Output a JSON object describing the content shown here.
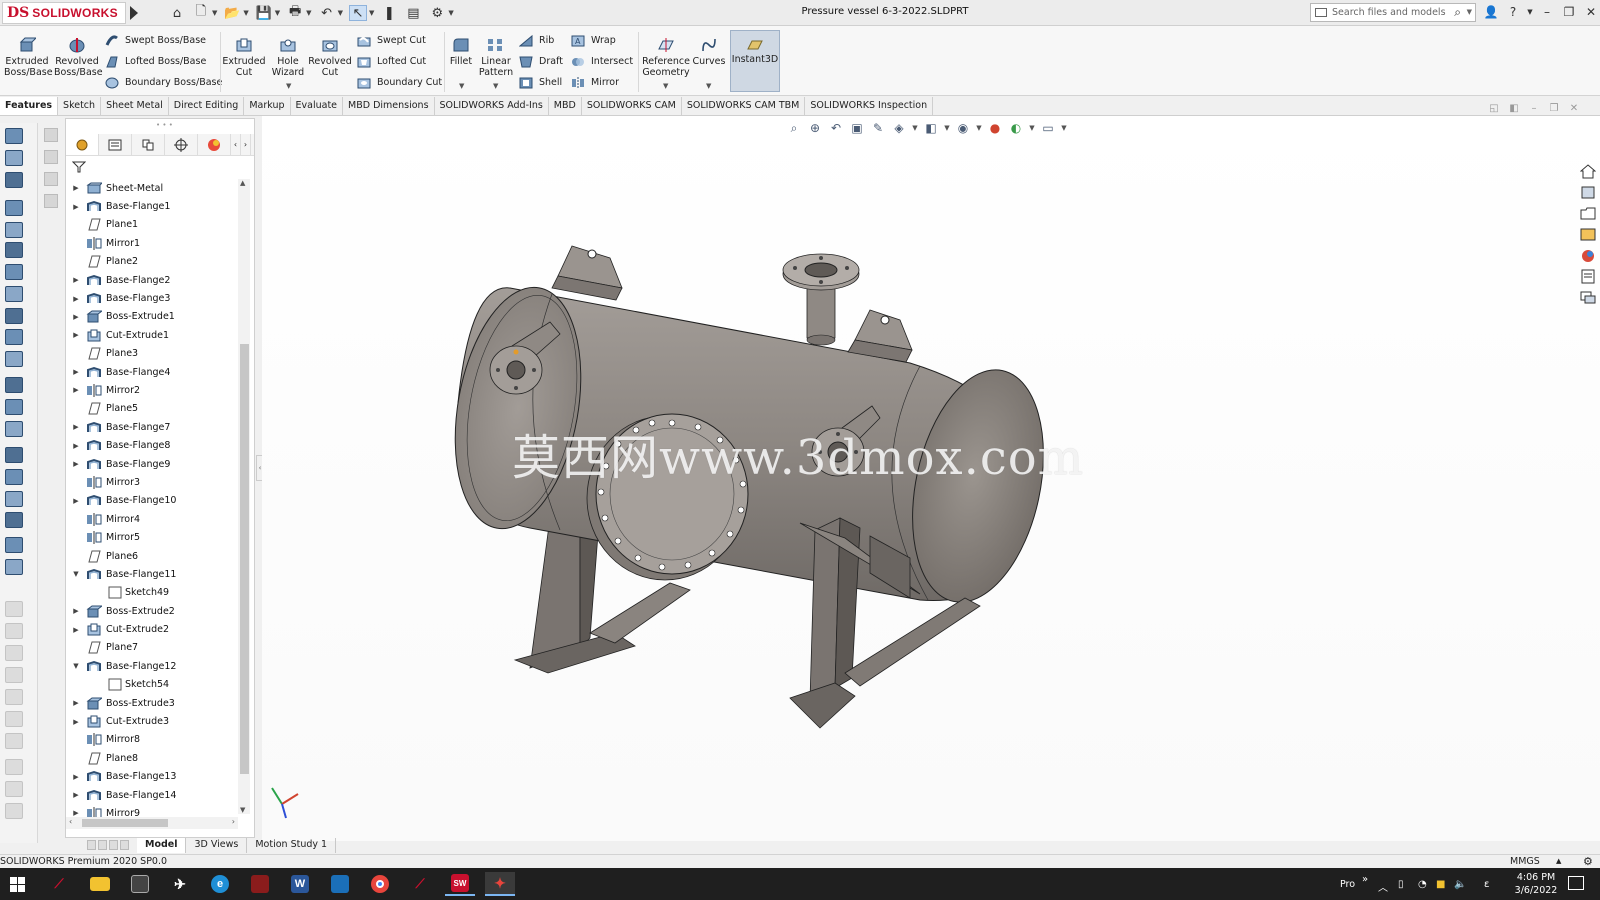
{
  "app": {
    "document_title": "Pressure vessel 6-3-2022.SLDPRT",
    "search_placeholder": "Search files and models",
    "logo_ds": "DS",
    "logo_brand": "SOLIDWORKS"
  },
  "ribbon": {
    "extruded_boss": "Extruded Boss/Base",
    "revolved_boss": "Revolved Boss/Base",
    "swept_boss": "Swept Boss/Base",
    "lofted_boss": "Lofted Boss/Base",
    "boundary_boss": "Boundary Boss/Base",
    "extruded_cut": "Extruded Cut",
    "hole_wizard": "Hole Wizard",
    "revolved_cut": "Revolved Cut",
    "swept_cut": "Swept Cut",
    "lofted_cut": "Lofted Cut",
    "boundary_cut": "Boundary Cut",
    "fillet": "Fillet",
    "linear_pattern": "Linear Pattern",
    "rib": "Rib",
    "draft": "Draft",
    "shell": "Shell",
    "wrap": "Wrap",
    "intersect": "Intersect",
    "mirror": "Mirror",
    "reference_geometry": "Reference Geometry",
    "curves": "Curves",
    "instant3d": "Instant3D"
  },
  "tabs": [
    "Features",
    "Sketch",
    "Sheet Metal",
    "Direct Editing",
    "Markup",
    "Evaluate",
    "MBD Dimensions",
    "SOLIDWORKS Add-Ins",
    "MBD",
    "SOLIDWORKS CAM",
    "SOLIDWORKS CAM TBM",
    "SOLIDWORKS Inspection"
  ],
  "tree": [
    {
      "label": "Sheet-Metal",
      "type": "sheetmetal",
      "expand": "right"
    },
    {
      "label": "Base-Flange1",
      "type": "flange",
      "expand": "right"
    },
    {
      "label": "Plane1",
      "type": "plane",
      "expand": ""
    },
    {
      "label": "Mirror1",
      "type": "mirror",
      "expand": ""
    },
    {
      "label": "Plane2",
      "type": "plane",
      "expand": ""
    },
    {
      "label": "Base-Flange2",
      "type": "flange",
      "expand": "right"
    },
    {
      "label": "Base-Flange3",
      "type": "flange",
      "expand": "right"
    },
    {
      "label": "Boss-Extrude1",
      "type": "boss",
      "expand": "right"
    },
    {
      "label": "Cut-Extrude1",
      "type": "cut",
      "expand": "right"
    },
    {
      "label": "Plane3",
      "type": "plane",
      "expand": ""
    },
    {
      "label": "Base-Flange4",
      "type": "flange",
      "expand": "right"
    },
    {
      "label": "Mirror2",
      "type": "mirror",
      "expand": "right"
    },
    {
      "label": "Plane5",
      "type": "plane",
      "expand": ""
    },
    {
      "label": "Base-Flange7",
      "type": "flange",
      "expand": "right"
    },
    {
      "label": "Base-Flange8",
      "type": "flange",
      "expand": "right"
    },
    {
      "label": "Base-Flange9",
      "type": "flange",
      "expand": "right"
    },
    {
      "label": "Mirror3",
      "type": "mirror",
      "expand": ""
    },
    {
      "label": "Base-Flange10",
      "type": "flange",
      "expand": "right"
    },
    {
      "label": "Mirror4",
      "type": "mirror",
      "expand": ""
    },
    {
      "label": "Mirror5",
      "type": "mirror",
      "expand": ""
    },
    {
      "label": "Plane6",
      "type": "plane",
      "expand": ""
    },
    {
      "label": "Base-Flange11",
      "type": "flange",
      "expand": "down"
    },
    {
      "label": "Sketch49",
      "type": "sketch",
      "expand": "",
      "child": true
    },
    {
      "label": "Boss-Extrude2",
      "type": "boss",
      "expand": "right"
    },
    {
      "label": "Cut-Extrude2",
      "type": "cut",
      "expand": "right"
    },
    {
      "label": "Plane7",
      "type": "plane",
      "expand": ""
    },
    {
      "label": "Base-Flange12",
      "type": "flange",
      "expand": "down"
    },
    {
      "label": "Sketch54",
      "type": "sketch",
      "expand": "",
      "child": true
    },
    {
      "label": "Boss-Extrude3",
      "type": "boss",
      "expand": "right"
    },
    {
      "label": "Cut-Extrude3",
      "type": "cut",
      "expand": "right"
    },
    {
      "label": "Mirror8",
      "type": "mirror",
      "expand": ""
    },
    {
      "label": "Plane8",
      "type": "plane",
      "expand": ""
    },
    {
      "label": "Base-Flange13",
      "type": "flange",
      "expand": "right"
    },
    {
      "label": "Base-Flange14",
      "type": "flange",
      "expand": "right"
    },
    {
      "label": "Mirror9",
      "type": "mirror",
      "expand": "right"
    }
  ],
  "watermark": "莫西网www.3dmox.com",
  "bottom_tabs": [
    "Model",
    "3D Views",
    "Motion Study 1"
  ],
  "status": {
    "text": "SOLIDWORKS Premium 2020 SP0.0",
    "units": "MMGS"
  },
  "taskbar": {
    "tray_label": "Pro",
    "time": "4:06 PM",
    "date": "3/6/2022",
    "sw_badge": "SW"
  },
  "colors": {
    "brand": "#c8102e",
    "vessel": "#8d8782",
    "taskbar": "#1f1f1f"
  }
}
